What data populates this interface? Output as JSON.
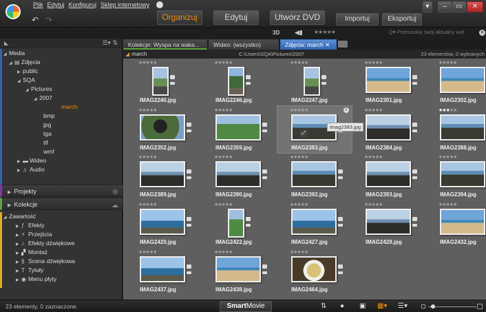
{
  "menu": [
    "Plik",
    "Edytuj",
    "Konfiguruj",
    "Sklep internetowy"
  ],
  "modes": {
    "organize": "Organizuj",
    "edit": "Edytuj",
    "dvd": "Utwórz DVD",
    "import": "Importuj",
    "export": "Eksportuj"
  },
  "toolbar": {
    "label_3d": "3D",
    "search_placeholder": "Przeszukaj swój aktualny wid"
  },
  "sidebar": {
    "media": "Media",
    "photos": "Zdjęcia",
    "public": "public",
    "sqa": "SQA",
    "pictures": "Pictures",
    "y2007": "2007",
    "march": "march",
    "bmp": "bmp",
    "jpg": "jpg",
    "tga": "tga",
    "tif": "tif",
    "wmf": "wmf",
    "video": "Wideo",
    "audio": "Audio",
    "projects": "Projekty",
    "collections": "Kolekcje",
    "content": "Zawartość",
    "effects": "Efekty",
    "transitions": "Przejścia",
    "sound_effects": "Efekty dźwiękowe",
    "montage": "Montaż",
    "sound_scene": "Scena dźwiękowa",
    "titles": "Tytuły",
    "disc_menu": "Menu płyty"
  },
  "tabs": [
    {
      "label": "Kolekcje: Wyspa na waka..."
    },
    {
      "label": "Wideo: (wszystko)"
    },
    {
      "label": "Zdjęcia: march"
    }
  ],
  "path": {
    "folder": "march",
    "location": "C:\\Users\\SQA\\Pictures\\2007",
    "count": "23 elementów, 0 wybranych"
  },
  "photos": [
    {
      "name": "IMAG2240.jpg",
      "img": "i-road",
      "orient": "port",
      "rating": 0
    },
    {
      "name": "IMAG2246.jpg",
      "img": "i-tree",
      "orient": "port",
      "rating": 0
    },
    {
      "name": "IMAG2247.jpg",
      "img": "i-road",
      "orient": "port",
      "rating": 0
    },
    {
      "name": "IMAG2301.jpg",
      "img": "i-beach",
      "orient": "land",
      "rating": 0
    },
    {
      "name": "IMAG2302.jpg",
      "img": "i-beach",
      "orient": "land",
      "rating": 0
    },
    {
      "name": "IMAG2352.jpg",
      "img": "i-tunnel",
      "orient": "land",
      "rating": 0
    },
    {
      "name": "IMAG2359.jpg",
      "img": "i-green",
      "orient": "land",
      "rating": 0
    },
    {
      "name": "IMAG2383.jpg",
      "img": "i-coast",
      "orient": "land",
      "rating": 0,
      "selected": true
    },
    {
      "name": "IMAG2384.jpg",
      "img": "i-rock",
      "orient": "land",
      "rating": 0
    },
    {
      "name": "IMAG2388.jpg",
      "img": "i-coast",
      "orient": "land",
      "rating": 3
    },
    {
      "name": "IMAG2389.jpg",
      "img": "i-rock",
      "orient": "land",
      "rating": 0
    },
    {
      "name": "IMAG2390.jpg",
      "img": "i-rock",
      "orient": "land",
      "rating": 0
    },
    {
      "name": "IMAG2392.jpg",
      "img": "i-coast",
      "orient": "land",
      "rating": 0
    },
    {
      "name": "IMAG2393.jpg",
      "img": "i-rock",
      "orient": "land",
      "rating": 0
    },
    {
      "name": "IMAG2394.jpg",
      "img": "i-coast",
      "orient": "land",
      "rating": 0
    },
    {
      "name": "IMAG2420.jpg",
      "img": "i-sea",
      "orient": "land",
      "rating": 0
    },
    {
      "name": "IMAG2422.jpg",
      "img": "i-green",
      "orient": "port",
      "rating": 0
    },
    {
      "name": "IMAG2427.jpg",
      "img": "i-sea",
      "orient": "land",
      "rating": 0
    },
    {
      "name": "IMAG2428.jpg",
      "img": "i-rock",
      "orient": "land",
      "rating": 0
    },
    {
      "name": "IMAG2432.jpg",
      "img": "i-beach",
      "orient": "land",
      "rating": 0
    },
    {
      "name": "IMAG2437.jpg",
      "img": "i-sea",
      "orient": "land",
      "rating": 0
    },
    {
      "name": "IMAG2438.jpg",
      "img": "i-beach",
      "orient": "land",
      "rating": 0
    },
    {
      "name": "IMAG2464.jpg",
      "img": "i-food",
      "orient": "land",
      "rating": 0
    }
  ],
  "tooltip": "imag2383.jpg",
  "status": {
    "message": "23 elementy, 0 zaznaczone.",
    "smart": "Smart",
    "movie": "Movie"
  }
}
